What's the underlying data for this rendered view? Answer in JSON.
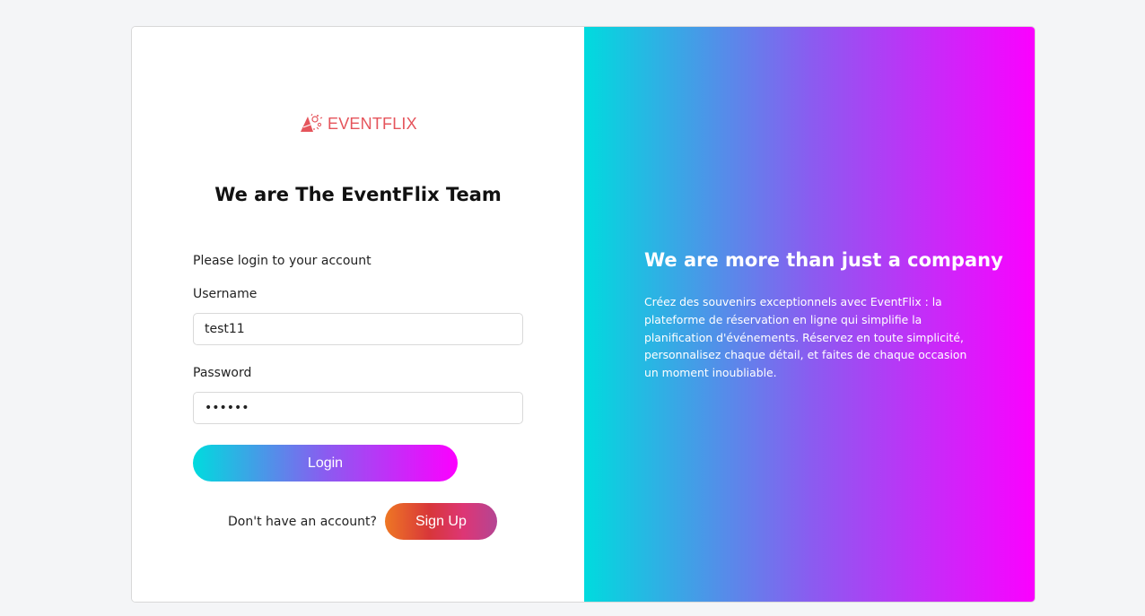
{
  "brand": {
    "logo_text": "EVENTFLIX",
    "logo_icon": "party-cone-icon",
    "logo_color": "#e5545b"
  },
  "login": {
    "title": "We are The EventFlix Team",
    "prompt": "Please login to your account",
    "username_label": "Username",
    "username_value": "test11",
    "password_label": "Password",
    "password_value": "••••••",
    "login_button": "Login",
    "signup_prompt": "Don't have an account?",
    "signup_button": "Sign Up"
  },
  "promo": {
    "title": "We are more than just a company",
    "description": "Créez des souvenirs exceptionnels avec EventFlix : la plateforme de réservation en ligne qui simplifie la planification d'événements. Réservez en toute simplicité, personnalisez chaque détail, et faites de chaque occasion un moment inoubliable."
  },
  "colors": {
    "gradient_start": "#00dbde",
    "gradient_end": "#fc00ff",
    "signup_gradient_start": "#ee7724",
    "signup_gradient_end": "#b44593"
  }
}
